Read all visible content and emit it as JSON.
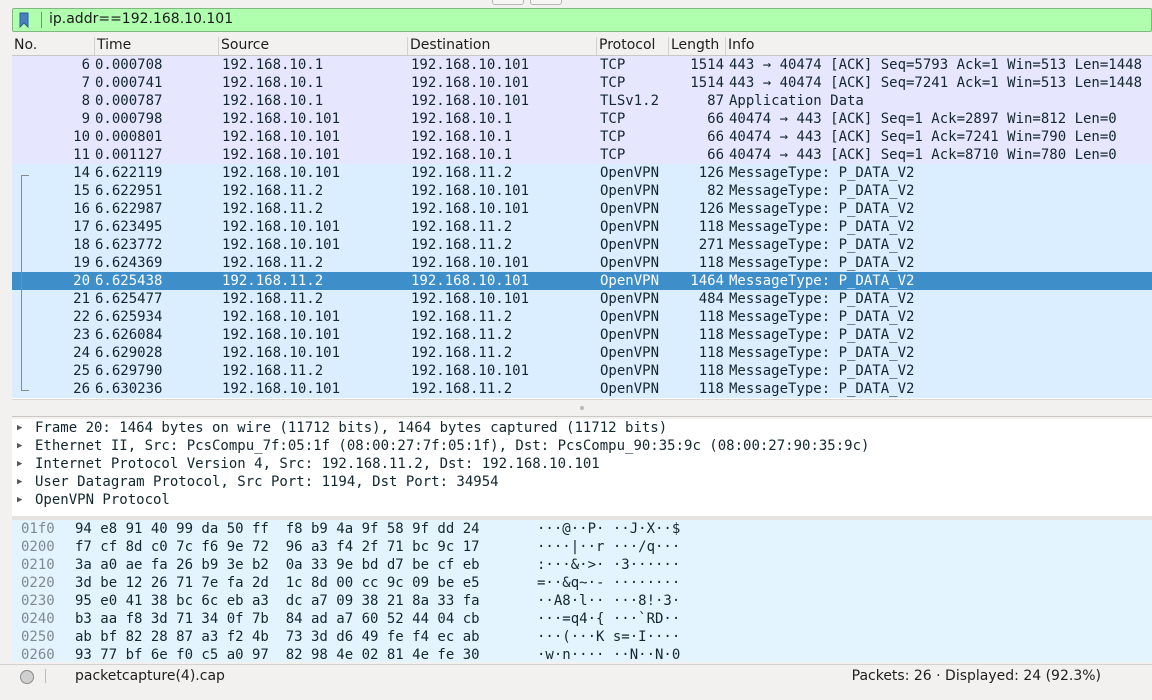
{
  "filter": {
    "value": "ip.addr==192.168.10.101"
  },
  "columns": {
    "no": "No.",
    "time": "Time",
    "source": "Source",
    "destination": "Destination",
    "protocol": "Protocol",
    "length": "Length",
    "info": "Info"
  },
  "packets": [
    {
      "no": "6",
      "time": "0.000708",
      "src": "192.168.10.1",
      "dst": "192.168.10.101",
      "proto": "TCP",
      "len": "1514",
      "info": "443 → 40474 [ACK] Seq=5793 Ack=1 Win=513 Len=1448",
      "style": "tcp"
    },
    {
      "no": "7",
      "time": "0.000741",
      "src": "192.168.10.1",
      "dst": "192.168.10.101",
      "proto": "TCP",
      "len": "1514",
      "info": "443 → 40474 [ACK] Seq=7241 Ack=1 Win=513 Len=1448",
      "style": "tcp"
    },
    {
      "no": "8",
      "time": "0.000787",
      "src": "192.168.10.1",
      "dst": "192.168.10.101",
      "proto": "TLSv1.2",
      "len": "87",
      "info": "Application Data",
      "style": "tcp"
    },
    {
      "no": "9",
      "time": "0.000798",
      "src": "192.168.10.101",
      "dst": "192.168.10.1",
      "proto": "TCP",
      "len": "66",
      "info": "40474 → 443 [ACK] Seq=1 Ack=2897 Win=812 Len=0",
      "style": "tcp"
    },
    {
      "no": "10",
      "time": "0.000801",
      "src": "192.168.10.101",
      "dst": "192.168.10.1",
      "proto": "TCP",
      "len": "66",
      "info": "40474 → 443 [ACK] Seq=1 Ack=7241 Win=790 Len=0",
      "style": "tcp"
    },
    {
      "no": "11",
      "time": "0.001127",
      "src": "192.168.10.101",
      "dst": "192.168.10.1",
      "proto": "TCP",
      "len": "66",
      "info": "40474 → 443 [ACK] Seq=1 Ack=8710 Win=780 Len=0",
      "style": "tcp"
    },
    {
      "no": "14",
      "time": "6.622119",
      "src": "192.168.10.101",
      "dst": "192.168.11.2",
      "proto": "OpenVPN",
      "len": "126",
      "info": "MessageType: P_DATA_V2",
      "style": "ovpn"
    },
    {
      "no": "15",
      "time": "6.622951",
      "src": "192.168.11.2",
      "dst": "192.168.10.101",
      "proto": "OpenVPN",
      "len": "82",
      "info": "MessageType: P_DATA_V2",
      "style": "ovpn"
    },
    {
      "no": "16",
      "time": "6.622987",
      "src": "192.168.11.2",
      "dst": "192.168.10.101",
      "proto": "OpenVPN",
      "len": "126",
      "info": "MessageType: P_DATA_V2",
      "style": "ovpn"
    },
    {
      "no": "17",
      "time": "6.623495",
      "src": "192.168.10.101",
      "dst": "192.168.11.2",
      "proto": "OpenVPN",
      "len": "118",
      "info": "MessageType: P_DATA_V2",
      "style": "ovpn"
    },
    {
      "no": "18",
      "time": "6.623772",
      "src": "192.168.10.101",
      "dst": "192.168.11.2",
      "proto": "OpenVPN",
      "len": "271",
      "info": "MessageType: P_DATA_V2",
      "style": "ovpn"
    },
    {
      "no": "19",
      "time": "6.624369",
      "src": "192.168.11.2",
      "dst": "192.168.10.101",
      "proto": "OpenVPN",
      "len": "118",
      "info": "MessageType: P_DATA_V2",
      "style": "ovpn"
    },
    {
      "no": "20",
      "time": "6.625438",
      "src": "192.168.11.2",
      "dst": "192.168.10.101",
      "proto": "OpenVPN",
      "len": "1464",
      "info": "MessageType: P_DATA_V2",
      "style": "sel"
    },
    {
      "no": "21",
      "time": "6.625477",
      "src": "192.168.11.2",
      "dst": "192.168.10.101",
      "proto": "OpenVPN",
      "len": "484",
      "info": "MessageType: P_DATA_V2",
      "style": "ovpn"
    },
    {
      "no": "22",
      "time": "6.625934",
      "src": "192.168.10.101",
      "dst": "192.168.11.2",
      "proto": "OpenVPN",
      "len": "118",
      "info": "MessageType: P_DATA_V2",
      "style": "ovpn"
    },
    {
      "no": "23",
      "time": "6.626084",
      "src": "192.168.10.101",
      "dst": "192.168.11.2",
      "proto": "OpenVPN",
      "len": "118",
      "info": "MessageType: P_DATA_V2",
      "style": "ovpn"
    },
    {
      "no": "24",
      "time": "6.629028",
      "src": "192.168.10.101",
      "dst": "192.168.11.2",
      "proto": "OpenVPN",
      "len": "118",
      "info": "MessageType: P_DATA_V2",
      "style": "ovpn"
    },
    {
      "no": "25",
      "time": "6.629790",
      "src": "192.168.11.2",
      "dst": "192.168.10.101",
      "proto": "OpenVPN",
      "len": "118",
      "info": "MessageType: P_DATA_V2",
      "style": "ovpn"
    },
    {
      "no": "26",
      "time": "6.630236",
      "src": "192.168.10.101",
      "dst": "192.168.11.2",
      "proto": "OpenVPN",
      "len": "118",
      "info": "MessageType: P_DATA_V2",
      "style": "ovpn"
    }
  ],
  "details": [
    "Frame 20: 1464 bytes on wire (11712 bits), 1464 bytes captured (11712 bits)",
    "Ethernet II, Src: PcsCompu_7f:05:1f (08:00:27:7f:05:1f), Dst: PcsCompu_90:35:9c (08:00:27:90:35:9c)",
    "Internet Protocol Version 4, Src: 192.168.11.2, Dst: 192.168.10.101",
    "User Datagram Protocol, Src Port: 1194, Dst Port: 34954",
    "OpenVPN Protocol"
  ],
  "hex": [
    {
      "offset": "01f0",
      "bytes": "94 e8 91 40 99 da 50 ff  f8 b9 4a 9f 58 9f dd 24",
      "ascii": "···@··P· ··J·X··$"
    },
    {
      "offset": "0200",
      "bytes": "f7 cf 8d c0 7c f6 9e 72  96 a3 f4 2f 71 bc 9c 17",
      "ascii": "····|··r ···/q···"
    },
    {
      "offset": "0210",
      "bytes": "3a a0 ae fa 26 b9 3e b2  0a 33 9e bd d7 be cf eb",
      "ascii": ":···&·>· ·3······"
    },
    {
      "offset": "0220",
      "bytes": "3d be 12 26 71 7e fa 2d  1c 8d 00 cc 9c 09 be e5",
      "ascii": "=··&q~·- ········"
    },
    {
      "offset": "0230",
      "bytes": "95 e0 41 38 bc 6c eb a3  dc a7 09 38 21 8a 33 fa",
      "ascii": "··A8·l·· ···8!·3·"
    },
    {
      "offset": "0240",
      "bytes": "b3 aa f8 3d 71 34 0f 7b  84 ad a7 60 52 44 04 cb",
      "ascii": "···=q4·{ ···`RD··"
    },
    {
      "offset": "0250",
      "bytes": "ab bf 82 28 87 a3 f2 4b  73 3d d6 49 fe f4 ec ab",
      "ascii": "···(···K s=·I····"
    },
    {
      "offset": "0260",
      "bytes": "93 77 bf 6e f0 c5 a0 97  82 98 4e 02 81 4e fe 30",
      "ascii": "·w·n···· ··N··N·0"
    }
  ],
  "status": {
    "file": "packetcapture(4).cap",
    "stats": "Packets: 26 · Displayed: 24 (92.3%)"
  },
  "colors": {
    "tcp_row": "#e7e6ff",
    "openvpn_row": "#daeeff",
    "selected_row": "#3d8ec9",
    "filter_valid": "#afffaf",
    "hex_bg": "#e3f4ff"
  }
}
